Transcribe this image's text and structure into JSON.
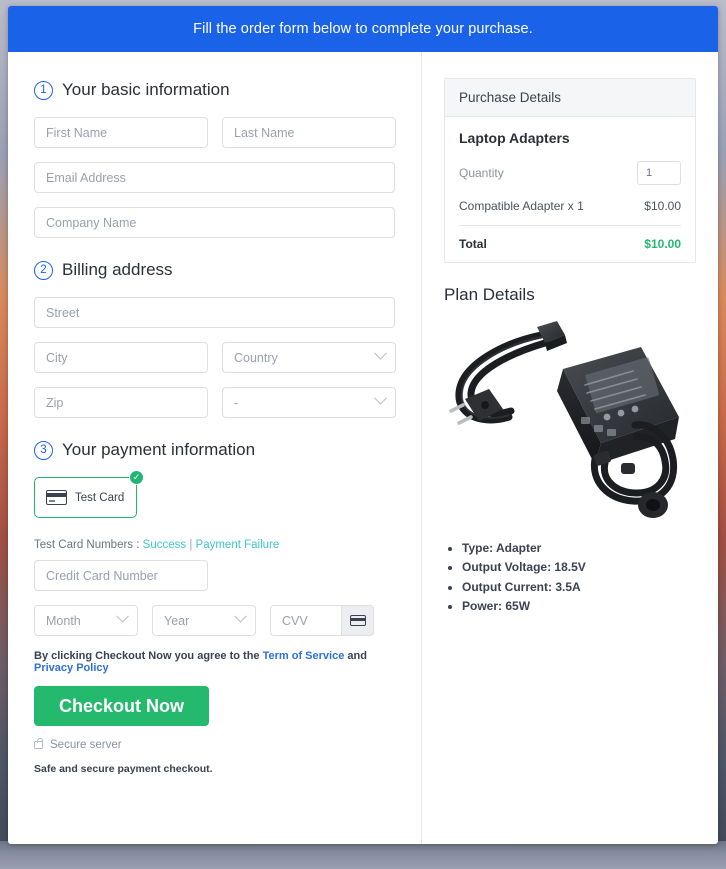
{
  "banner": {
    "text": "Fill the order form below to complete your purchase."
  },
  "steps": {
    "basic": {
      "num": "1",
      "title": "Your basic information"
    },
    "billing": {
      "num": "2",
      "title": "Billing address"
    },
    "payment": {
      "num": "3",
      "title": "Your payment information"
    }
  },
  "fields": {
    "first_name": "First Name",
    "last_name": "Last Name",
    "email": "Email Address",
    "company": "Company Name",
    "street": "Street",
    "city": "City",
    "country": "Country",
    "zip": "Zip",
    "state": "-",
    "card_number": "Credit Card Number",
    "month": "Month",
    "year": "Year",
    "cvv": "CVV"
  },
  "payment": {
    "tile_label": "Test Card",
    "badge": "✓",
    "test_numbers_label": "Test Card Numbers :",
    "success_link": "Success",
    "separator": "|",
    "failure_link": "Payment Failure"
  },
  "terms": {
    "prefix": "By clicking Checkout Now you agree to the",
    "tos": "Term of Service",
    "and": "and",
    "privacy": "Privacy Policy"
  },
  "actions": {
    "checkout": "Checkout Now",
    "secure_server": "Secure server",
    "safe_note": "Safe and secure payment checkout."
  },
  "purchase": {
    "header": "Purchase Details",
    "product": "Laptop Adapters",
    "quantity_label": "Quantity",
    "quantity_value": "1",
    "line_item": "Compatible Adapter x 1",
    "line_price": "$10.00",
    "total_label": "Total",
    "total_price": "$10.00"
  },
  "plan": {
    "title": "Plan Details",
    "specs": [
      "Type: Adapter",
      "Output Voltage: 18.5V",
      "Output Current: 3.5A",
      "Power: 65W"
    ]
  },
  "colors": {
    "banner_blue": "#1a62e8",
    "accent_green": "#25b96e",
    "link_blue": "#2e6fe0",
    "link_teal": "#3ec6c9"
  }
}
